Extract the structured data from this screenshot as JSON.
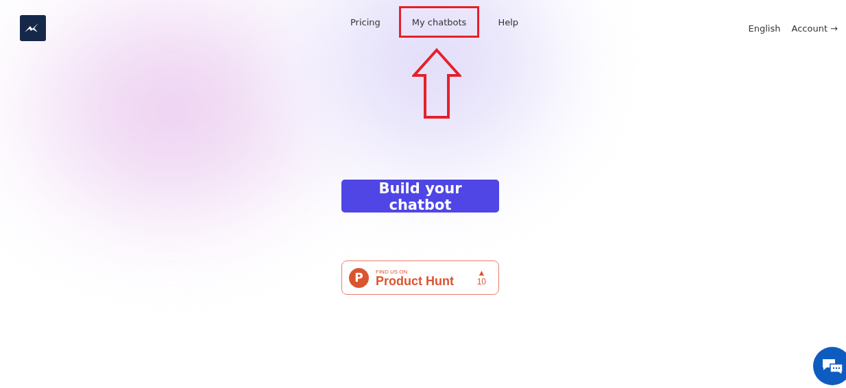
{
  "nav": [
    {
      "label": "Pricing",
      "highlighted": false
    },
    {
      "label": "My chatbots",
      "highlighted": true
    },
    {
      "label": "Help",
      "highlighted": false
    }
  ],
  "right_nav": {
    "language": "English",
    "account": "Account →"
  },
  "cta_button": {
    "label": "Build your chatbot"
  },
  "product_hunt_badge": {
    "logo_letter": "P",
    "kicker": "FIND US ON",
    "name": "Product Hunt",
    "upvote_mark": "▲",
    "upvotes": "10"
  }
}
